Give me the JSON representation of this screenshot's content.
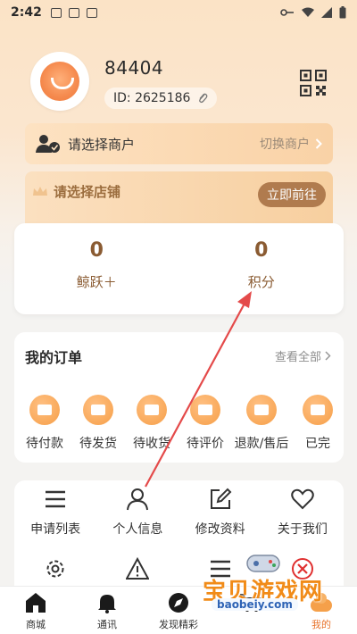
{
  "status_bar": {
    "time": "2:42"
  },
  "profile": {
    "username": "84404",
    "id_text": "ID: 2625186"
  },
  "merchant": {
    "label": "请选择商户",
    "switch_label": "切换商户"
  },
  "store": {
    "label": "请选择店铺",
    "go_label": "立即前往"
  },
  "stats": [
    {
      "value": "0",
      "label": "鲸跃＋"
    },
    {
      "value": "0",
      "label": "积分"
    }
  ],
  "orders": {
    "title": "我的订单",
    "view_all": "查看全部",
    "items": [
      {
        "label": "待付款",
        "icon": "wallet-icon"
      },
      {
        "label": "待发货",
        "icon": "truck-icon"
      },
      {
        "label": "待收货",
        "icon": "package-icon"
      },
      {
        "label": "待评价",
        "icon": "review-icon"
      },
      {
        "label": "退款/售后",
        "icon": "refund-icon"
      },
      {
        "label": "已完",
        "icon": "done-icon"
      }
    ]
  },
  "tools": {
    "row1": [
      {
        "label": "申请列表",
        "icon": "list-icon"
      },
      {
        "label": "个人信息",
        "icon": "person-icon"
      },
      {
        "label": "修改资料",
        "icon": "edit-icon"
      },
      {
        "label": "关于我们",
        "icon": "heart-icon"
      }
    ],
    "row2": [
      {
        "icon": "gear-icon"
      },
      {
        "icon": "warning-icon"
      },
      {
        "icon": "menu-icon"
      },
      {
        "icon": "close-circle-icon"
      }
    ]
  },
  "tabbar": [
    {
      "label": "商城",
      "icon": "home-icon"
    },
    {
      "label": "通讯",
      "icon": "bell-icon"
    },
    {
      "label": "发现精彩",
      "icon": "discover-icon"
    },
    {
      "label": "",
      "icon": "cart-icon"
    },
    {
      "label": "我的",
      "icon": "profile-icon",
      "active": true
    }
  ],
  "watermark": {
    "text": "宝贝游戏网",
    "sub": "baobeiy.com"
  },
  "colors": {
    "accent": "#8a5b32",
    "orange": "#f69f48",
    "tab_active": "#e8742d"
  }
}
